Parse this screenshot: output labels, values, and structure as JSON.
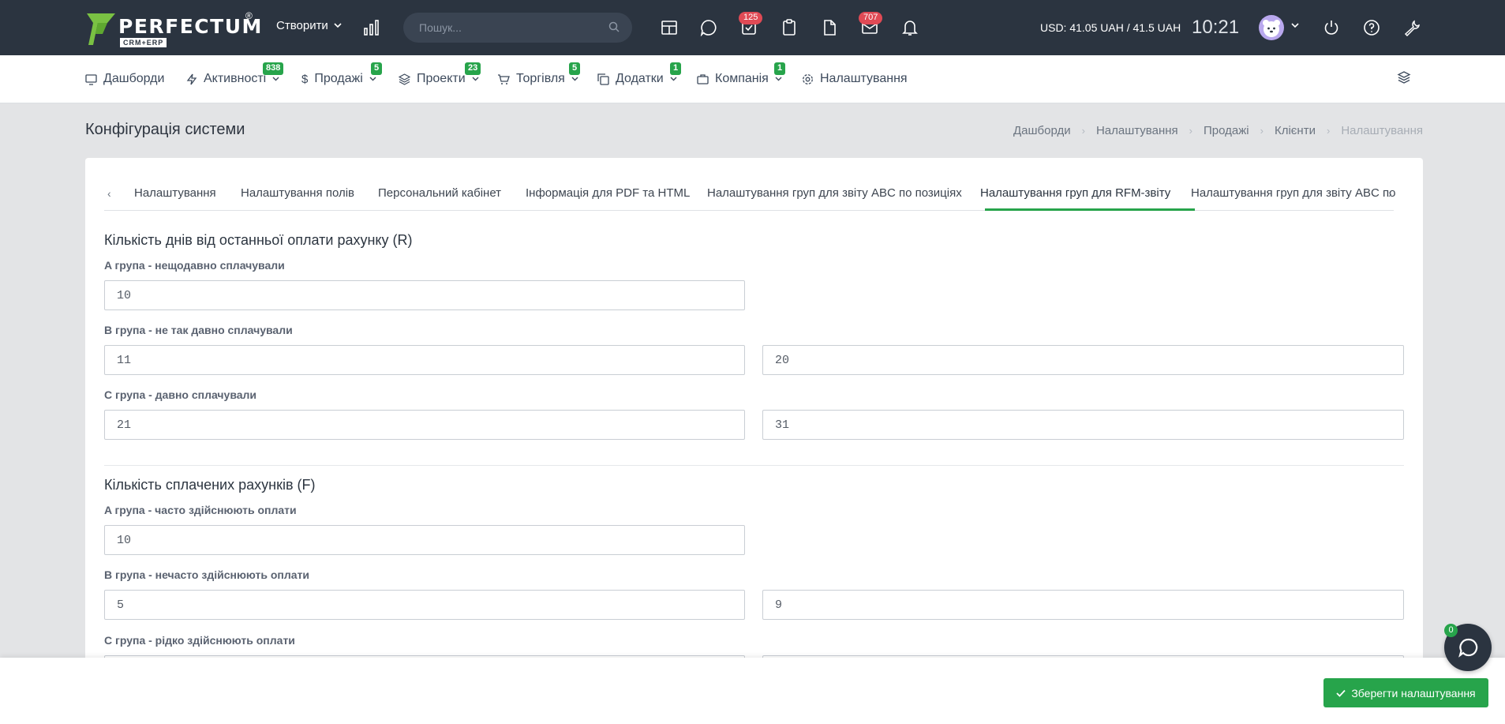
{
  "header": {
    "logo_text": "PERFECTUM",
    "logo_sub": "CRM+ERP",
    "logo_reg": "®",
    "create_label": "Створити",
    "search_placeholder": "Пошук...",
    "tasks_badge": "125",
    "mail_badge": "707",
    "currency": "USD: 41.05 UAH / 41.5 UAH",
    "time": "10:21"
  },
  "nav": {
    "items": [
      {
        "label": "Дашборди",
        "icon": "monitor-icon"
      },
      {
        "label": "Активності",
        "icon": "lightning-icon",
        "badge": "838"
      },
      {
        "label": "Продажі",
        "icon": "dollar-icon",
        "badge": "5"
      },
      {
        "label": "Проекти",
        "icon": "layers-icon",
        "badge": "23"
      },
      {
        "label": "Торгівля",
        "icon": "cart-icon",
        "badge": "5"
      },
      {
        "label": "Додатки",
        "icon": "copy-icon",
        "badge": "1"
      },
      {
        "label": "Компанія",
        "icon": "briefcase-icon",
        "badge": "1"
      },
      {
        "label": "Налаштування",
        "icon": "gear-icon"
      }
    ]
  },
  "page": {
    "title": "Конфігурація системи",
    "breadcrumb": [
      "Дашборди",
      "Налаштування",
      "Продажі",
      "Клієнти",
      "Налаштування"
    ]
  },
  "tabs": [
    "Налаштування",
    "Налаштування полів",
    "Персональний кабінет",
    "Інформація для PDF та HTML",
    "Налаштування груп для звіту ABC по позиціях",
    "Налаштування груп для RFM-звіту",
    "Налаштування груп для звіту ABC по"
  ],
  "active_tab_index": 5,
  "sections": {
    "r": {
      "title": "Кількість днів від останньої оплати рахунку (R)",
      "a_label": "A група - нещодавно сплачували",
      "a_value": "10",
      "b_label": "B група - не так давно сплачували",
      "b_from": "11",
      "b_to": "20",
      "c_label": "C група - давно сплачували",
      "c_from": "21",
      "c_to": "31"
    },
    "f": {
      "title": "Кількість сплачених рахунків (F)",
      "a_label": "A група - часто здійснюють оплати",
      "a_value": "10",
      "b_label": "B група - нечасто здійснюють оплати",
      "b_from": "5",
      "b_to": "9",
      "c_label": "C група - рідко здійснюють оплати"
    }
  },
  "footer": {
    "save_label": "Зберегти налаштування",
    "chat_badge": "0"
  },
  "colors": {
    "accent_green": "#27a44b",
    "header_bg": "#2b3440",
    "badge_red": "#e04a55"
  }
}
